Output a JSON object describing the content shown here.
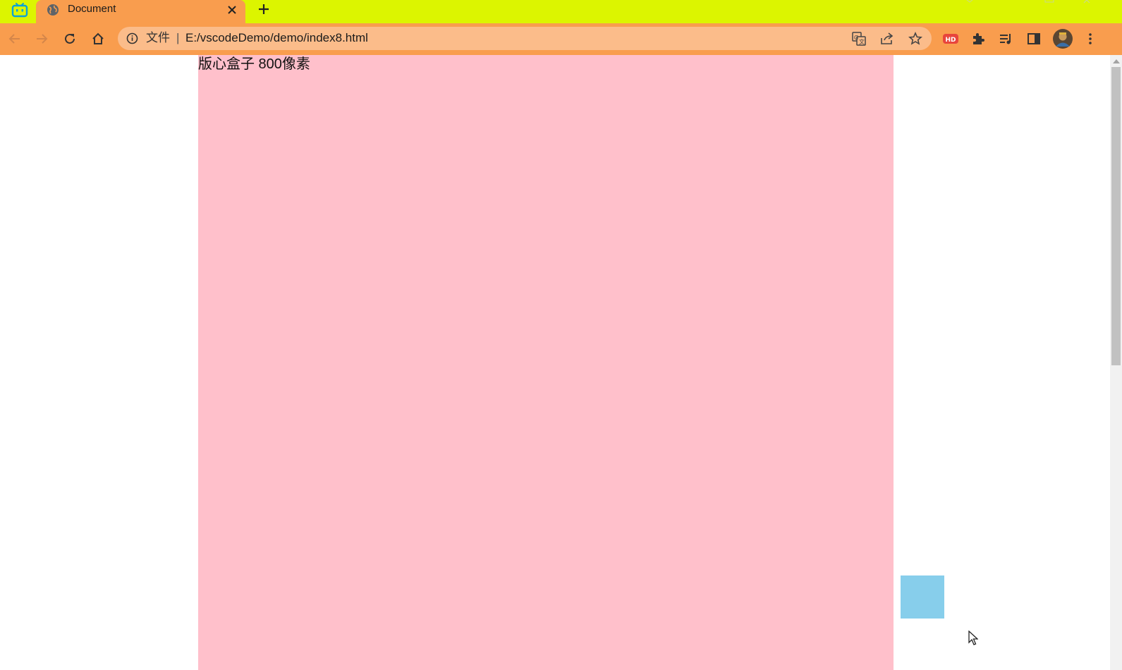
{
  "browser": {
    "tab": {
      "title": "Document"
    },
    "new_tab_symbol": "+",
    "address_bar": {
      "scheme_label": "文件",
      "separator": "|",
      "url": "E:/vscodeDemo/demo/index8.html"
    },
    "extension_badge": "HD",
    "icons": [
      "bilibili-icon",
      "globe-icon",
      "close-icon",
      "plus-icon",
      "back-icon",
      "forward-icon",
      "reload-icon",
      "home-icon",
      "info-icon",
      "translate-icon",
      "share-icon",
      "bookmark-star-icon",
      "extensions-icon",
      "reading-list-icon",
      "side-panel-icon",
      "profile-avatar",
      "more-menu-icon"
    ]
  },
  "page": {
    "layout_box_text": "版心盒子 800像素",
    "colors": {
      "layout_box": "#ffc0cb",
      "fixed_box": "#87ceeb",
      "tabstrip": "#dcf500",
      "toolbar": "#f99d4e",
      "omnibox": "#fbbc8a",
      "badge": "#e8453c"
    }
  }
}
